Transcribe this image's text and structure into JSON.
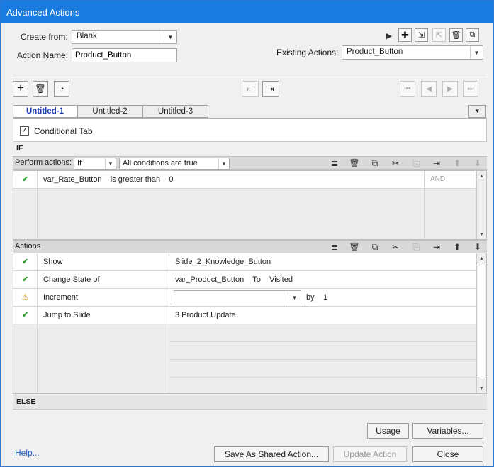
{
  "window": {
    "title": "Advanced Actions"
  },
  "header": {
    "create_from_label": "Create from:",
    "create_from_value": "Blank",
    "action_name_label": "Action Name:",
    "action_name_value": "Product_Button",
    "existing_actions_label": "Existing Actions:",
    "existing_actions_value": "Product_Button"
  },
  "tabs": [
    {
      "label": "Untitled-1",
      "active": true
    },
    {
      "label": "Untitled-2",
      "active": false
    },
    {
      "label": "Untitled-3",
      "active": false
    }
  ],
  "conditional": {
    "label": "Conditional Tab",
    "checked": true
  },
  "if_section": {
    "title": "IF",
    "perform_label": "Perform actions:",
    "perform_value": "If",
    "conditions_value": "All conditions are true",
    "rows": [
      {
        "variable": "var_Rate_Button",
        "operator": "is greater than",
        "value": "0",
        "logic": "AND"
      }
    ]
  },
  "actions_section": {
    "title": "Actions",
    "rows": [
      {
        "status": "check",
        "action": "Show",
        "target": "Slide_2_Knowledge_Button"
      },
      {
        "status": "check",
        "action": "Change State of",
        "target": "var_Product_Button",
        "to_label": "To",
        "state": "Visited"
      },
      {
        "status": "warning",
        "action": "Increment",
        "by_label": "by",
        "by_value": "1"
      },
      {
        "status": "check",
        "action": "Jump to Slide",
        "target": "3 Product Update"
      }
    ]
  },
  "else_section": {
    "title": "ELSE"
  },
  "buttons": {
    "usage": "Usage",
    "variables": "Variables...",
    "help": "Help...",
    "save_shared": "Save As Shared Action...",
    "update": "Update Action",
    "close": "Close"
  },
  "icons": {
    "check_color": "#2e9e2e",
    "warning_color": "#d69a00",
    "accent": "#1a7ce0"
  }
}
